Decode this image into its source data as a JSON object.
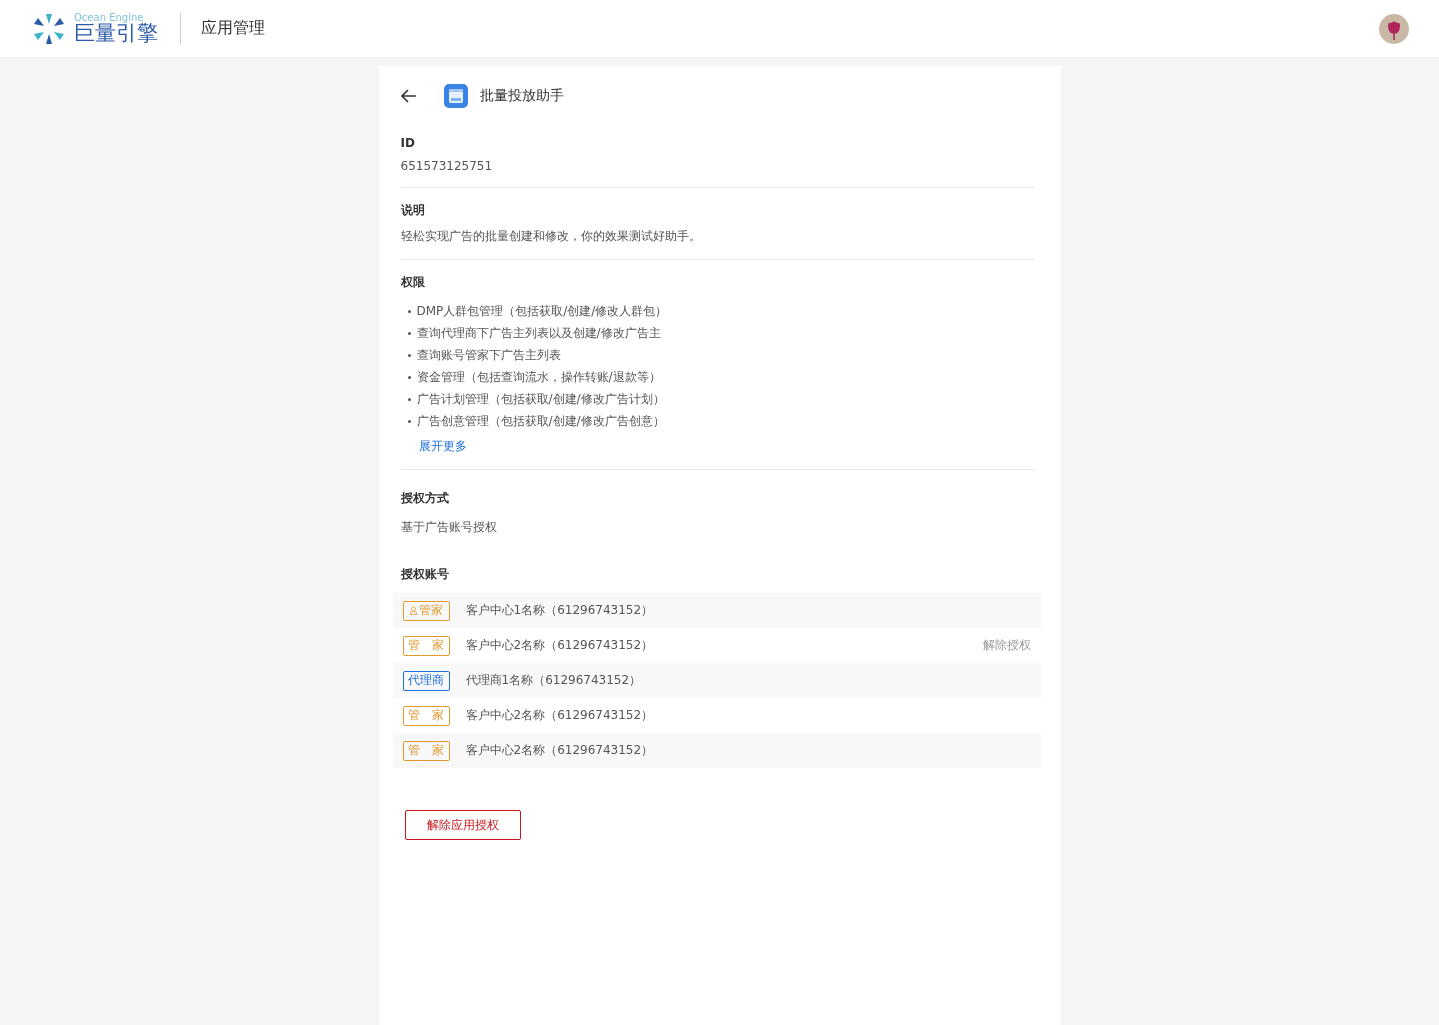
{
  "header": {
    "logo_en": "Ocean Engine",
    "logo_cn": "巨量引擎",
    "title": "应用管理"
  },
  "app": {
    "name": "批量投放助手"
  },
  "id": {
    "label": "ID",
    "value": "651573125751"
  },
  "description": {
    "label": "说明",
    "text": "轻松实现广告的批量创建和修改，你的效果测试好助手。"
  },
  "permissions": {
    "label": "权限",
    "items": [
      "DMP人群包管理（包括获取/创建/修改人群包）",
      "查询代理商下广告主列表以及创建/修改广告主",
      "查询账号管家下广告主列表",
      "资金管理（包括查询流水，操作转账/退款等）",
      "广告计划管理（包括获取/创建/修改广告计划）",
      "广告创意管理（包括获取/创建/修改广告创意）"
    ],
    "expand_link": "展开更多"
  },
  "auth_method": {
    "label": "授权方式",
    "value": "基于广告账号授权"
  },
  "accounts": {
    "label": "授权账号",
    "rows": [
      {
        "kind": "manager",
        "tag": "管家",
        "tag_icon": true,
        "name": "客户中心1名称（61296743152）"
      },
      {
        "kind": "manager",
        "tag": "管　家",
        "tag_icon": false,
        "name": "客户中心2名称（61296743152）",
        "action": "解除授权"
      },
      {
        "kind": "agent",
        "tag": "代理商",
        "tag_icon": false,
        "name": "代理商1名称（61296743152）"
      },
      {
        "kind": "manager",
        "tag": "管　家",
        "tag_icon": false,
        "name": "客户中心2名称（61296743152）"
      },
      {
        "kind": "manager",
        "tag": "管　家",
        "tag_icon": false,
        "name": "客户中心2名称（61296743152）"
      }
    ]
  },
  "revoke_button": "解除应用授权"
}
